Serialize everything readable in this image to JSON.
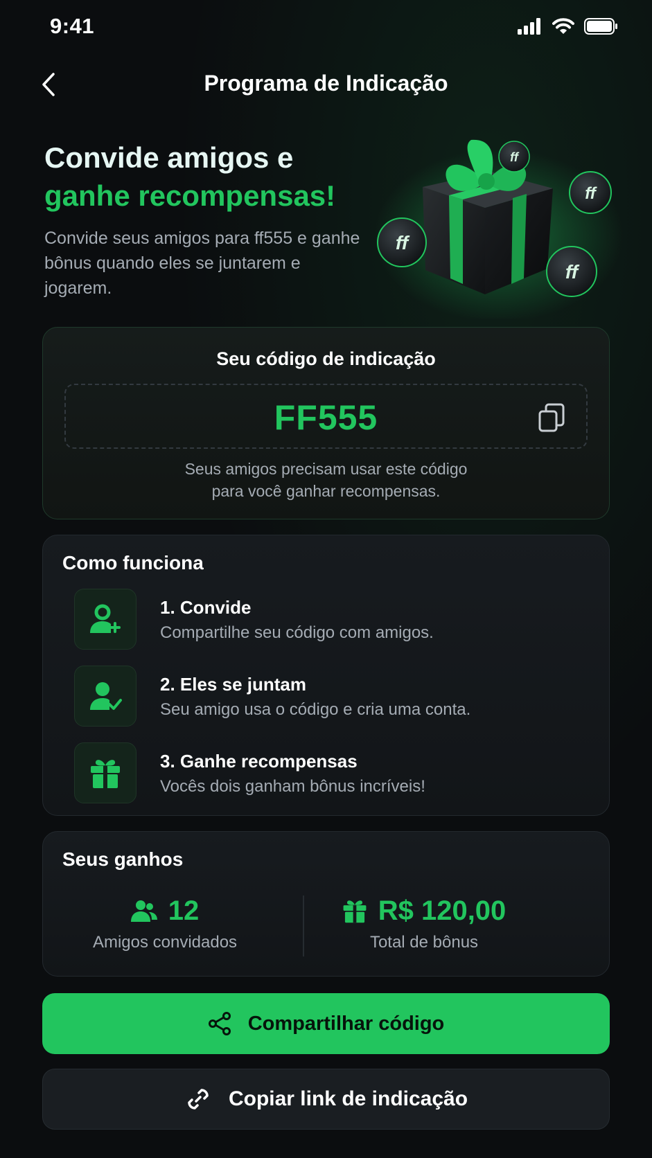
{
  "status_bar": {
    "time": "9:41"
  },
  "header": {
    "title": "Programa de Indicação"
  },
  "hero": {
    "title_line1": "Convide amigos e",
    "title_line2": "ganhe recompensas!",
    "description": "Convide seus amigos para ff555 e ganhe bônus quando eles se juntarem e jogarem.",
    "coin_label": "ff"
  },
  "referral": {
    "label": "Seu código de indicação",
    "code": "FF555",
    "help_line1": "Seus amigos precisam usar este código",
    "help_line2": "para você ganhar recompensas."
  },
  "how_it_works": {
    "title": "Como funciona",
    "steps": [
      {
        "title": "1. Convide",
        "description": "Compartilhe seu código com amigos.",
        "icon": "user-plus-icon"
      },
      {
        "title": "2. Eles se juntam",
        "description": "Seu amigo usa o código e cria uma conta.",
        "icon": "user-check-icon"
      },
      {
        "title": "3. Ganhe recompensas",
        "description": "Vocês dois ganham bônus incríveis!",
        "icon": "gift-icon"
      }
    ]
  },
  "earnings": {
    "title": "Seus ganhos",
    "friends_count": "12",
    "friends_label": "Amigos convidados",
    "bonus_total": "R$ 120,00",
    "bonus_label": "Total de bônus"
  },
  "actions": {
    "share_label": "Compartilhar código",
    "copy_link_label": "Copiar link de indicação"
  },
  "colors": {
    "accent": "#22c55e",
    "background": "#0b0d0f",
    "card": "#15191c",
    "muted_text": "#a5acb4"
  }
}
